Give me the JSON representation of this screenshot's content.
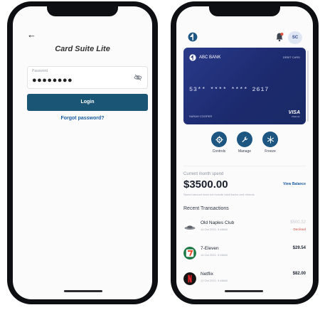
{
  "login_screen": {
    "title": "Card Suite Lite",
    "password_label": "Password",
    "password_value": "●●●●●●●●",
    "login_label": "Login",
    "forgot_label": "Forgot password?"
  },
  "dashboard": {
    "avatar_initials": "SC",
    "card": {
      "bank_name": "ABC BANK",
      "card_type": "DEBIT CARD",
      "number": "53** **** **** 2617",
      "holder": "SARAH COOPER",
      "network": "VISA",
      "network_sub": "Platinum"
    },
    "actions": [
      {
        "label": "Controls"
      },
      {
        "label": "Manage"
      },
      {
        "label": "Freeze"
      }
    ],
    "spend": {
      "label": "Current month spend",
      "amount": "$3500.00",
      "view_balance": "View Balance",
      "note": "Spend amount does not include cash backs and refunds"
    },
    "recent_title": "Recent Transactions",
    "transactions": [
      {
        "name": "Old Naples Club",
        "date": "14 Oct 2021, 9:46AM",
        "amount": "$500.32",
        "status": "Declined"
      },
      {
        "name": "7-Eleven",
        "date": "14 Oct 2021, 9:46AM",
        "amount": "$29.54",
        "status": ""
      },
      {
        "name": "Netflix",
        "date": "12 Oct 2021, 9:46AM",
        "amount": "$82.00",
        "status": ""
      }
    ],
    "colors": {
      "primary": "#1a5576",
      "card": "#1c2a6e",
      "link": "#1a5b9e",
      "declined": "#d24a3a"
    }
  }
}
